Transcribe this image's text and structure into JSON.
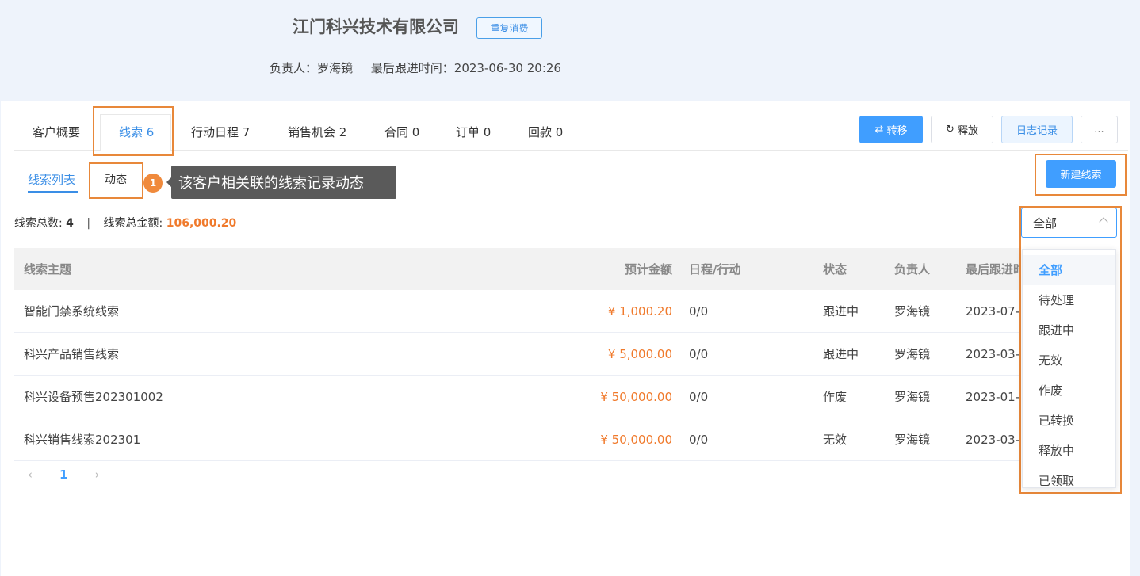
{
  "header": {
    "company": "江门科兴技术有限公司",
    "repeat_label": "重复消费",
    "owner": "负责人：罗海镜",
    "last_follow": "最后跟进时间：2023-06-30 20:26"
  },
  "tabs": [
    {
      "label": "客户概要"
    },
    {
      "label": "线索 6"
    },
    {
      "label": "行动日程 7"
    },
    {
      "label": "销售机会 2"
    },
    {
      "label": "合同 0"
    },
    {
      "label": "订单 0"
    },
    {
      "label": "回款 0"
    }
  ],
  "actions": {
    "transfer": "转移",
    "release": "释放",
    "log": "日志记录",
    "more": "..."
  },
  "subtabs": {
    "list": "线索列表",
    "activity": "动态"
  },
  "tooltip": {
    "number": "1",
    "text": "该客户相关联的线索记录动态"
  },
  "new_button": "新建线索",
  "summary": {
    "count_label": "线索总数:",
    "count": "4",
    "sep": "|",
    "amount_label": "线索总金额:",
    "amount": "106,000.20"
  },
  "filter": {
    "selected": "全部",
    "options": [
      "全部",
      "待处理",
      "跟进中",
      "无效",
      "作废",
      "已转换",
      "释放中",
      "已领取"
    ]
  },
  "table": {
    "headers": {
      "subject": "线索主题",
      "amount": "预计金额",
      "schedule": "日程/行动",
      "status": "状态",
      "owner": "负责人",
      "last": "最后跟进时"
    },
    "rows": [
      {
        "subject": "智能门禁系统线索",
        "amount": "¥ 1,000.20",
        "schedule": "0/0",
        "status": "跟进中",
        "owner": "罗海镜",
        "last": "2023-07-"
      },
      {
        "subject": "科兴产品销售线索",
        "amount": "¥ 5,000.00",
        "schedule": "0/0",
        "status": "跟进中",
        "owner": "罗海镜",
        "last": "2023-03-"
      },
      {
        "subject": "科兴设备预售202301002",
        "amount": "¥ 50,000.00",
        "schedule": "0/0",
        "status": "作废",
        "owner": "罗海镜",
        "last": "2023-01-"
      },
      {
        "subject": "科兴销售线索202301",
        "amount": "¥ 50,000.00",
        "schedule": "0/0",
        "status": "无效",
        "owner": "罗海镜",
        "last": "2023-03-"
      }
    ]
  },
  "pager": {
    "prev": "‹",
    "current": "1",
    "next": "›"
  }
}
